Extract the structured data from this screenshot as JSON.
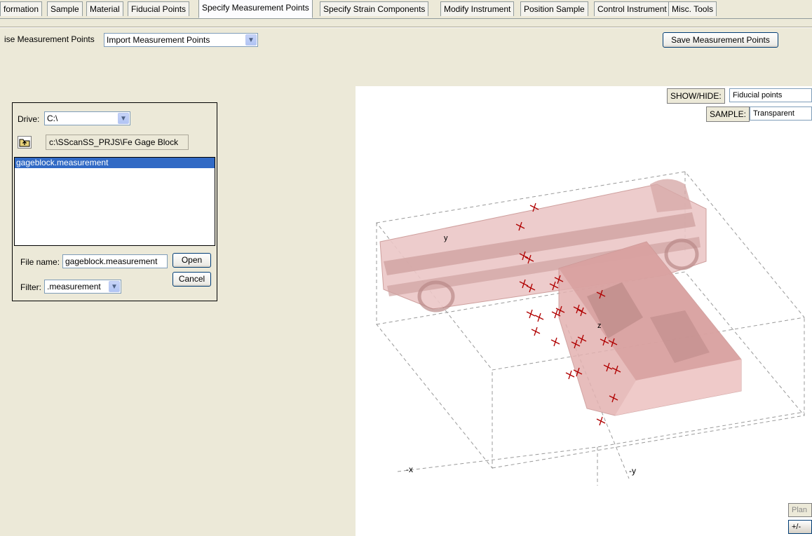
{
  "tabs": [
    {
      "label": "formation"
    },
    {
      "label": "Sample"
    },
    {
      "label": "Material"
    },
    {
      "label": "Fiducial Points"
    },
    {
      "label": "Specify Measurement Points"
    },
    {
      "label": "Specify Strain Components"
    },
    {
      "label": "Modify Instrument"
    },
    {
      "label": "Position Sample"
    },
    {
      "label": "Control Instrument"
    },
    {
      "label": "Misc. Tools"
    }
  ],
  "toolbar": {
    "label": "ise Measurement Points",
    "mode_select": "Import Measurement Points",
    "save_button": "Save Measurement Points"
  },
  "file_dialog": {
    "drive_label": "Drive:",
    "drive_value": "C:\\",
    "path": "c:\\SScanSS_PRJS\\Fe Gage Block",
    "files": [
      "gageblock.measurement"
    ],
    "selected_index": 0,
    "filename_label": "File name:",
    "filename_value": "gageblock.measurement",
    "open_button": "Open",
    "cancel_button": "Cancel",
    "filter_label": "Filter:",
    "filter_value": ".measurement"
  },
  "viewer": {
    "show_hide_label": "SHOW/HIDE:",
    "show_hide_value": "Fiducial points",
    "sample_label": "SAMPLE:",
    "sample_value": "Transparent",
    "axis_labels": {
      "neg_x": "-x",
      "neg_y": "-y",
      "z": "z",
      "y": "y"
    },
    "plane_button": "Plan",
    "plus_minus_button": "+/-",
    "colors": {
      "sample": "#e8bcbc",
      "sample_shade": "#c99593",
      "marker": "#b00000",
      "box": "#999999"
    }
  }
}
